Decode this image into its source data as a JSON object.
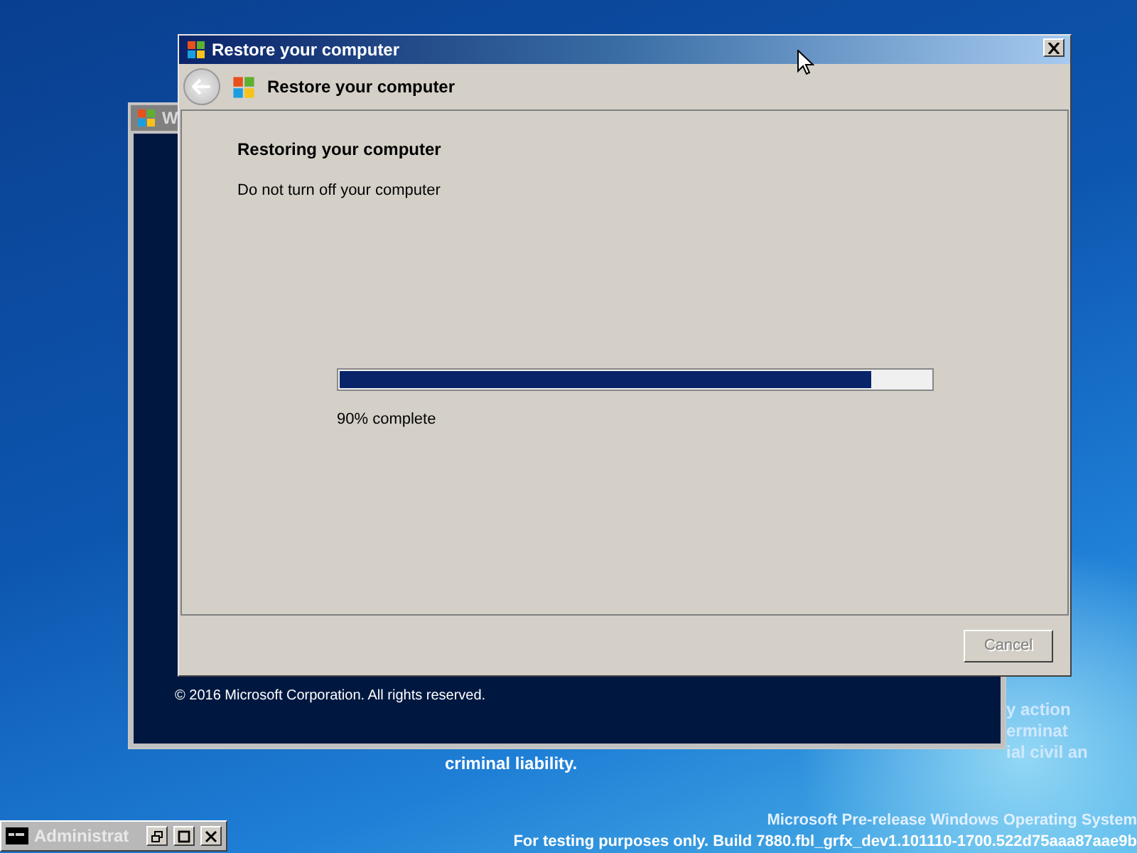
{
  "desktop": {
    "notice_fragments": [
      "y action",
      "erminat",
      "ial civil an"
    ],
    "notice_last_line": "criminal liability.",
    "build_lines": [
      "Microsoft Pre-release Windows Operating System",
      "For testing purposes only. Build 7880.fbl_grfx_dev1.101110-1700.522d75aaa87aae9b"
    ]
  },
  "background_window": {
    "title": "W",
    "copyright": "© 2016 Microsoft Corporation. All rights reserved."
  },
  "window": {
    "title": "Restore your computer",
    "header_title": "Restore your computer",
    "heading": "Restoring your computer",
    "message": "Do not turn off your computer",
    "progress": {
      "level": 0.9,
      "reading": "90% complete"
    },
    "cancel": {
      "label": "Cancel",
      "disabled": true
    }
  },
  "minimized_window": {
    "title": "Administrat"
  }
}
